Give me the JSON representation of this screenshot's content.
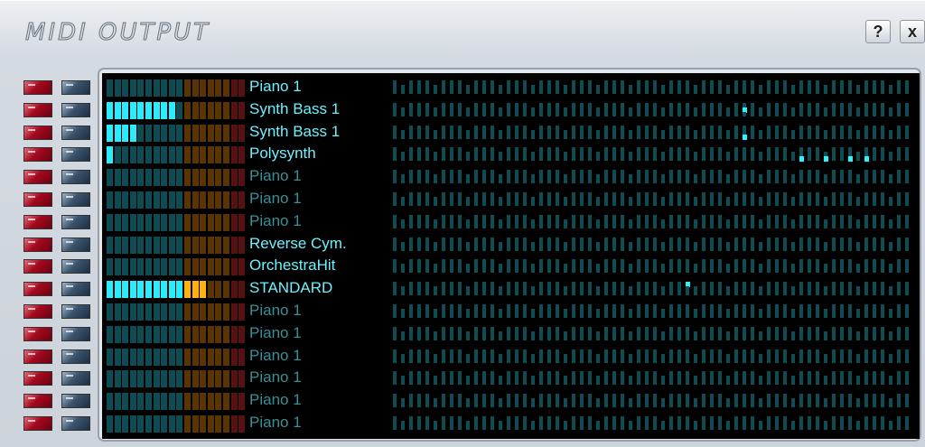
{
  "window": {
    "title": "MIDI OUTPUT",
    "help_label": "?",
    "close_label": "x"
  },
  "colors": {
    "meter_lit_cyan": "#29ecff",
    "meter_lit_orange": "#ffb10f",
    "meter_dim_teal": "#0f4b52",
    "meter_dim_orange": "#5b3404",
    "meter_dim_red": "#561212",
    "name_active": "#6cf1ff",
    "name_inactive": "#3b8f96",
    "step_dim": "#0f4d52",
    "step_lit": "#2ff2ff"
  },
  "channels": [
    {
      "name": "Piano 1",
      "active": true,
      "level": 0,
      "notes": []
    },
    {
      "name": "Synth Bass 1",
      "active": true,
      "level": 0.5,
      "notes": [
        {
          "row": 1,
          "col": 43
        }
      ]
    },
    {
      "name": "Synth Bass 1",
      "active": true,
      "level": 0.2,
      "notes": [
        {
          "row": 2,
          "col": 43
        }
      ]
    },
    {
      "name": "Polysynth",
      "active": true,
      "level": 0.05,
      "notes": [
        {
          "row": 2,
          "col": 50
        },
        {
          "row": 2,
          "col": 53
        },
        {
          "row": 2,
          "col": 56
        },
        {
          "row": 2,
          "col": 58
        }
      ]
    },
    {
      "name": "Piano 1",
      "active": false,
      "level": 0,
      "notes": []
    },
    {
      "name": "Piano 1",
      "active": false,
      "level": 0,
      "notes": []
    },
    {
      "name": "Piano 1",
      "active": false,
      "level": 0,
      "notes": []
    },
    {
      "name": "Reverse Cym.",
      "active": true,
      "level": 0,
      "notes": []
    },
    {
      "name": "OrchestraHit",
      "active": true,
      "level": 0,
      "notes": []
    },
    {
      "name": "STANDARD",
      "active": true,
      "level": 0.7,
      "notes": [
        {
          "row": 0,
          "col": 36
        }
      ]
    },
    {
      "name": "Piano 1",
      "active": false,
      "level": 0,
      "notes": []
    },
    {
      "name": "Piano 1",
      "active": false,
      "level": 0,
      "notes": []
    },
    {
      "name": "Piano 1",
      "active": false,
      "level": 0,
      "notes": []
    },
    {
      "name": "Piano 1",
      "active": false,
      "level": 0,
      "notes": []
    },
    {
      "name": "Piano 1",
      "active": false,
      "level": 0,
      "notes": []
    },
    {
      "name": "Piano 1",
      "active": false,
      "level": 0,
      "notes": []
    }
  ]
}
